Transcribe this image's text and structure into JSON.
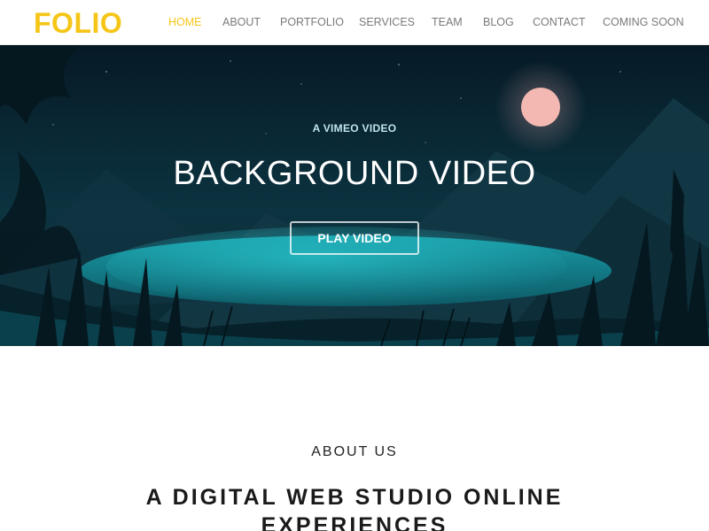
{
  "brand": {
    "logo": "FOLIO",
    "accent_color": "#f5c518"
  },
  "nav": {
    "items": [
      {
        "label": "HOME",
        "active": true
      },
      {
        "label": "ABOUT",
        "active": false
      },
      {
        "label": "PORTFOLIO",
        "active": false
      },
      {
        "label": "SERVICES",
        "active": false
      },
      {
        "label": "TEAM",
        "active": false
      },
      {
        "label": "BLOG",
        "active": false
      },
      {
        "label": "CONTACT",
        "active": false
      },
      {
        "label": "COMING SOON",
        "active": false
      }
    ]
  },
  "hero": {
    "kicker": "A VIMEO VIDEO",
    "title": "BACKGROUND VIDEO",
    "button_label": "PLAY VIDEO",
    "background": "night-landscape-with-moon-mountains-lake"
  },
  "about": {
    "label": "ABOUT US",
    "heading": "A DIGITAL WEB STUDIO ONLINE EXPERIENCES"
  }
}
